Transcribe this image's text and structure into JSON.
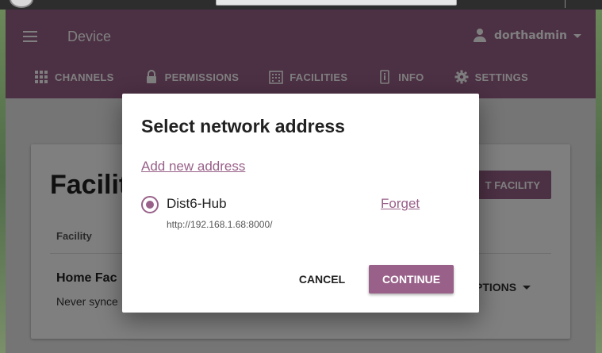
{
  "app": {
    "title": "Device",
    "user": "dorthadmin"
  },
  "tabs": [
    {
      "label": "CHANNELS",
      "icon": "grid-icon"
    },
    {
      "label": "PERMISSIONS",
      "icon": "lock-icon"
    },
    {
      "label": "FACILITIES",
      "icon": "building-icon"
    },
    {
      "label": "INFO",
      "icon": "info-icon"
    },
    {
      "label": "SETTINGS",
      "icon": "gear-icon"
    }
  ],
  "page": {
    "title": "Facilit",
    "import_button": "T FACILITY",
    "column_header": "Facility",
    "row_name": "Home Fac",
    "row_sub": "Never synce",
    "options_label": "PTIONS"
  },
  "dialog": {
    "title": "Select network address",
    "add_link": "Add new address",
    "address_name": "Dist6-Hub",
    "address_url": "http://192.168.1.68:8000/",
    "forget_link": "Forget",
    "cancel_button": "CANCEL",
    "continue_button": "CONTINUE"
  },
  "colors": {
    "brand": "#996189"
  }
}
